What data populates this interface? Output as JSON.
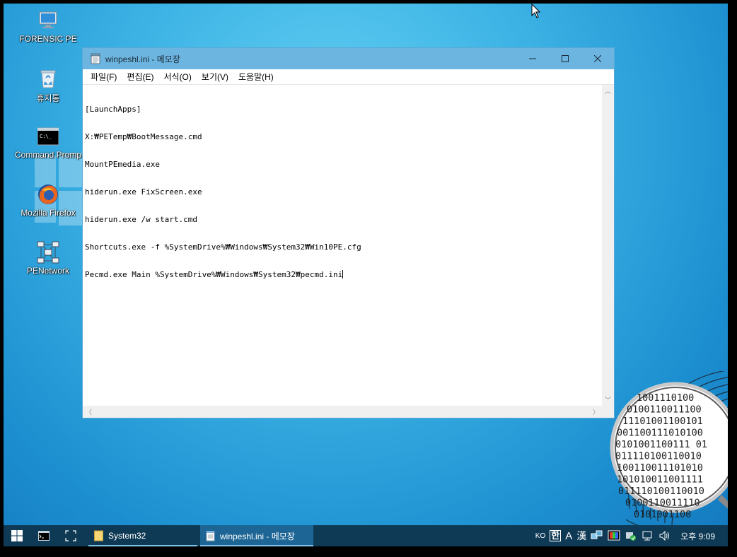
{
  "desktop": {
    "icons": [
      {
        "label": "FORENSIC PE",
        "icon": "computer-icon"
      },
      {
        "label": "휴지통",
        "icon": "recycle-bin-icon"
      },
      {
        "label": "Command Promp",
        "icon": "cmd-icon"
      },
      {
        "label": "Mozilla Firefox",
        "icon": "firefox-icon"
      },
      {
        "label": "PENetwork",
        "icon": "network-icon"
      }
    ]
  },
  "notepad": {
    "title": "winpeshl.ini - 메모장",
    "menu": [
      "파일(F)",
      "편집(E)",
      "서식(O)",
      "보기(V)",
      "도움말(H)"
    ],
    "lines": [
      "[LaunchApps]",
      "X:₩PETemp₩BootMessage.cmd",
      "MountPEmedia.exe",
      "hiderun.exe FixScreen.exe",
      "hiderun.exe /w start.cmd",
      "Shortcuts.exe -f %SystemDrive%₩Windows₩System32₩Win10PE.cfg",
      "Pecmd.exe Main %SystemDrive%₩Windows₩System32₩pecmd.ini"
    ]
  },
  "forensic_digits": [
    "1001110100",
    "0100110011100",
    "11101001100101",
    "001100111010100",
    "0101001100111 01",
    "011110100110010",
    "100110011101010",
    "101010011001111",
    "011110100110010",
    "0100110011110",
    "0101001100"
  ],
  "taskbar": {
    "tasks": [
      {
        "label": "System32",
        "icon": "folder-icon"
      },
      {
        "label": "winpeshl.ini - 메모장",
        "icon": "notepad-icon"
      }
    ],
    "tray": {
      "ime_lang": "KO",
      "ime_mode": "한",
      "ime_a": "A",
      "ime_hanja": "漢"
    },
    "clock": "오후 9:09"
  }
}
